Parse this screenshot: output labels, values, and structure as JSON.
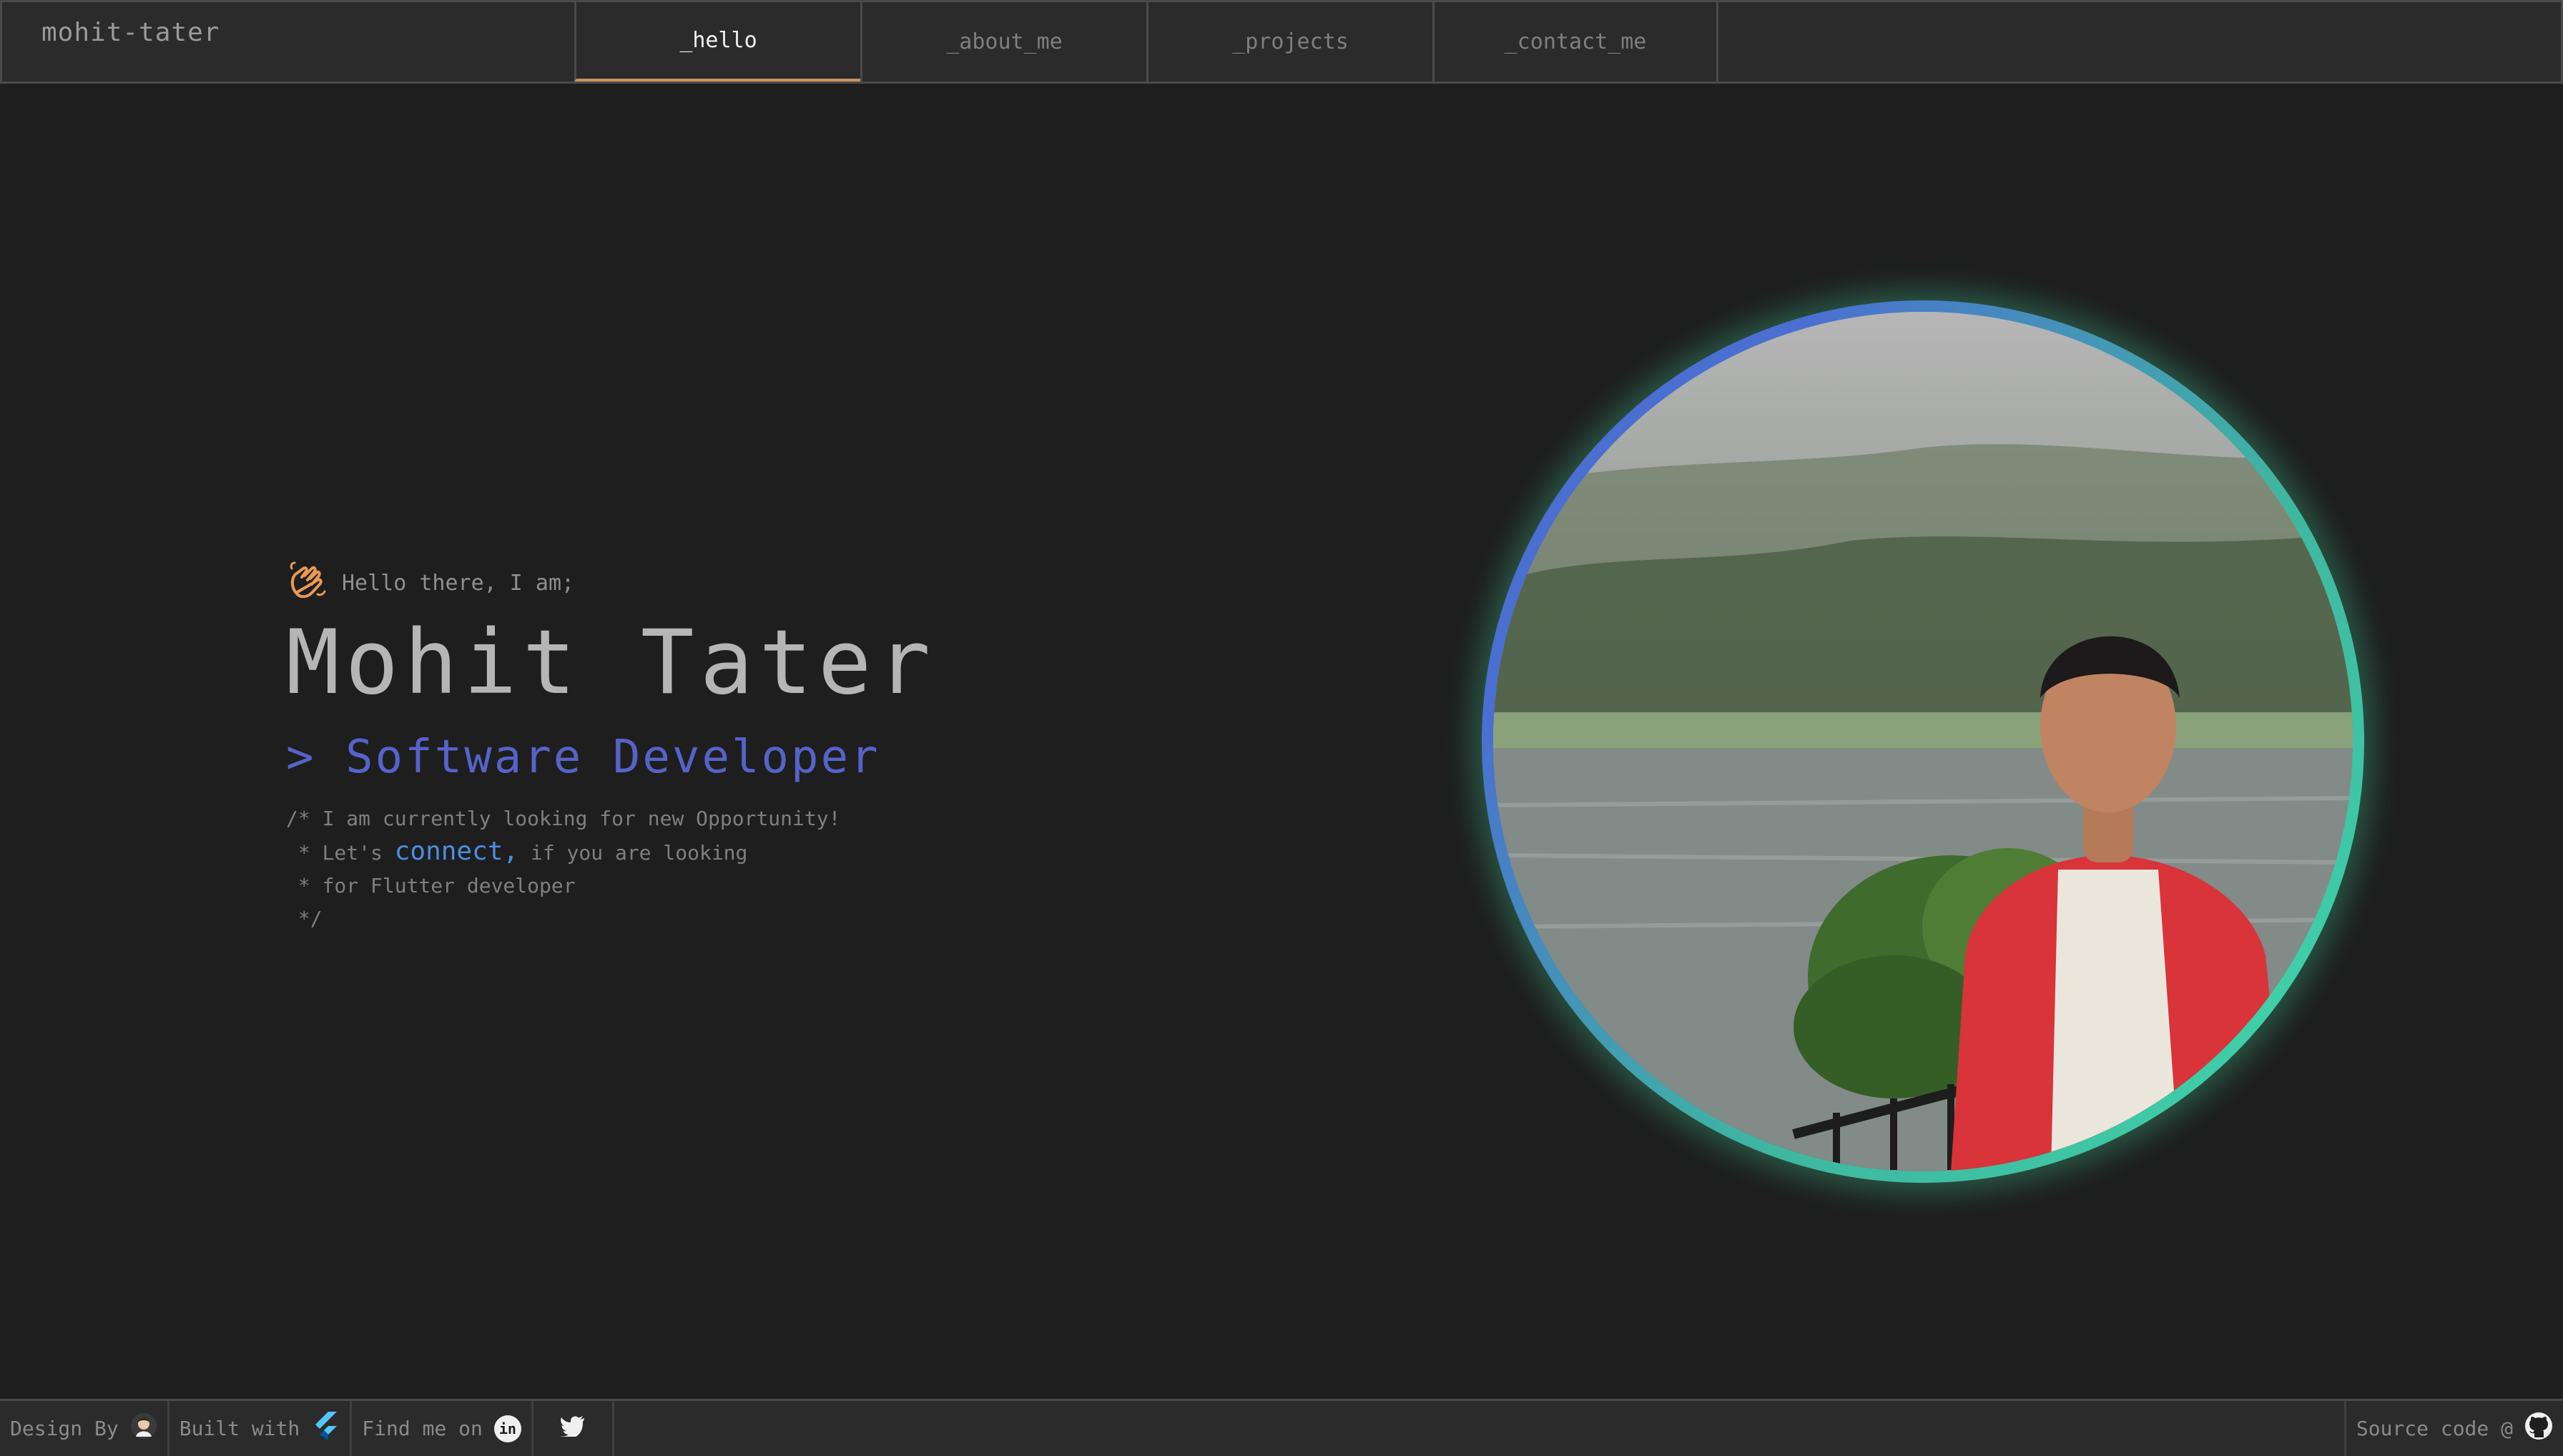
{
  "nav": {
    "brand": "mohit-tater",
    "tabs": [
      {
        "label": "_hello",
        "active": true
      },
      {
        "label": "_about_me",
        "active": false
      },
      {
        "label": "_projects",
        "active": false
      },
      {
        "label": "_contact_me",
        "active": false
      }
    ]
  },
  "hero": {
    "greeting": "Hello there, I am;",
    "name": "Mohit Tater",
    "role": "> Software Developer",
    "comment_line1": "/* I am currently looking for new Opportunity!",
    "comment_line2_prefix": " * Let's ",
    "comment_link": "connect,",
    "comment_line2_suffix": " if you are looking",
    "comment_line3": " * for Flutter developer",
    "comment_line4": " */"
  },
  "portrait": {
    "ring_colors": [
      "#4a6fd0",
      "#3fb7a0"
    ]
  },
  "footer": {
    "design_by": "Design By",
    "built_with": "Built with",
    "find_me_on": "Find me on",
    "source_code": "Source code @"
  },
  "colors": {
    "background": "#1e1e1e",
    "bar": "#2b2b2b",
    "accent_blue": "#5563c9",
    "link_blue": "#4a8fe0",
    "active_tab_underline": "#c9945c",
    "wave_icon": "#e89a55"
  },
  "icons": [
    "waving-hand-icon",
    "avatar-icon",
    "flutter-icon",
    "linkedin-icon",
    "twitter-icon",
    "github-icon"
  ]
}
